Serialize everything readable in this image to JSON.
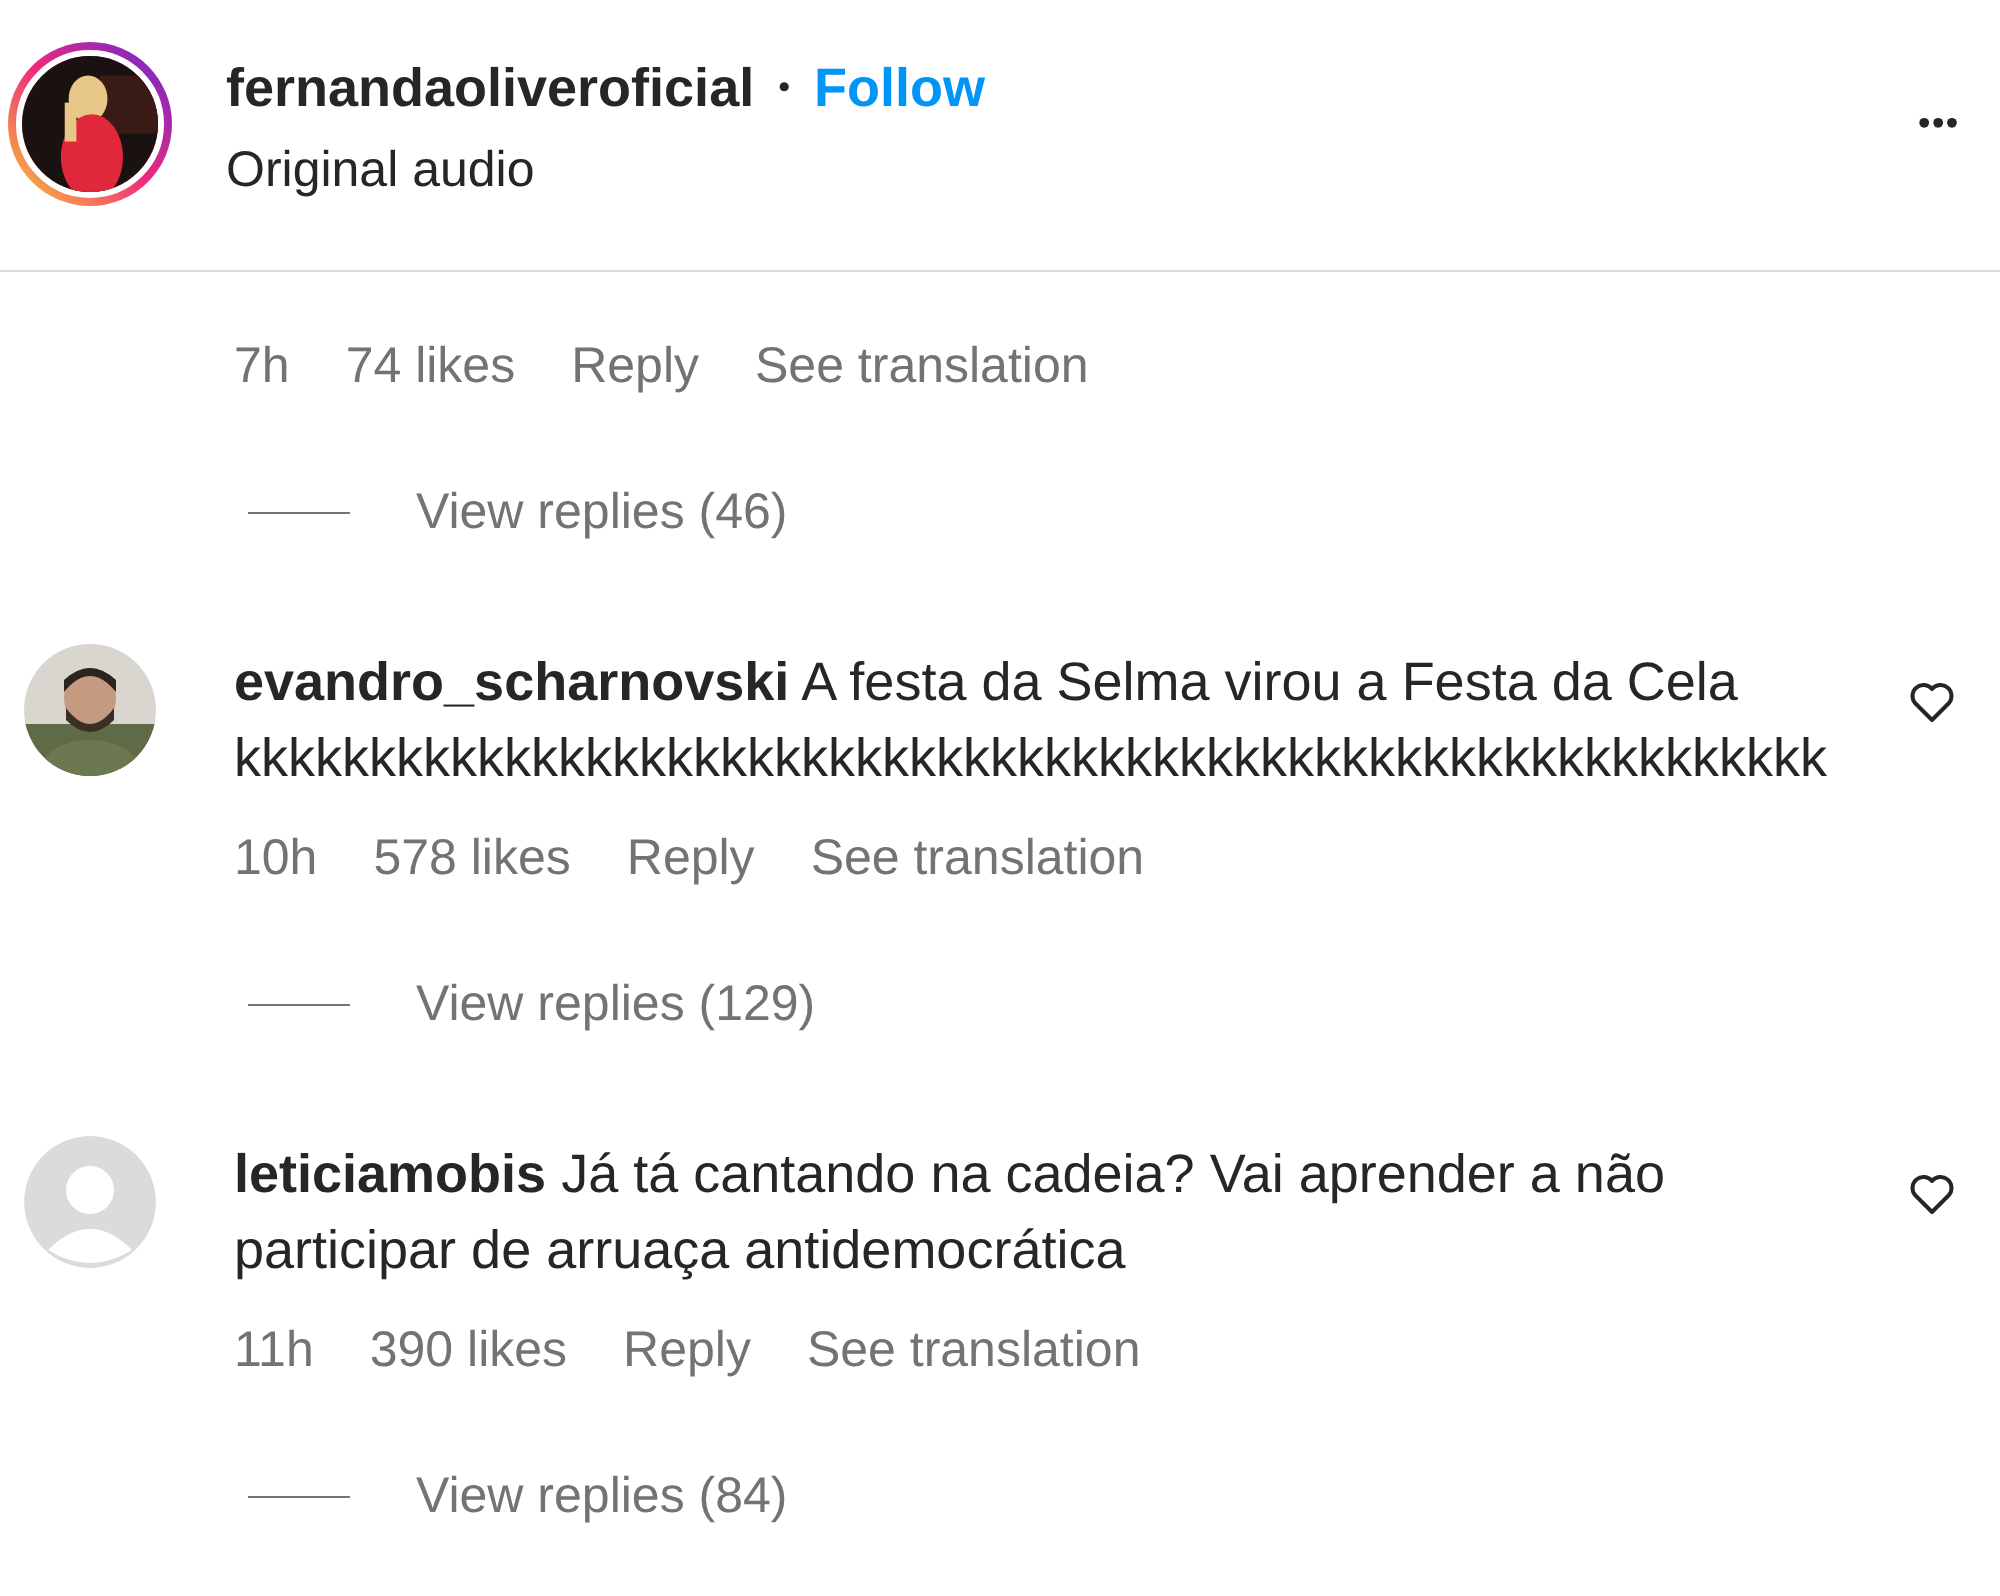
{
  "header": {
    "username": "fernandaoliveroficial",
    "separator": "•",
    "follow": "Follow",
    "subtitle": "Original audio",
    "more": "•••"
  },
  "comments": [
    {
      "kind": "partial",
      "time": "7h",
      "likes": "74 likes",
      "reply": "Reply",
      "translate": "See translation",
      "view_replies": "View replies (46)"
    },
    {
      "username": "evandro_scharnovski",
      "text": "A festa da Selma virou a Festa da Cela kkkkkkkkkkkkkkkkkkkkkkkkkkkkkkkkkkkkkkkkkkkkkkkkkkkkkkkkkkk",
      "time": "10h",
      "likes": "578 likes",
      "reply": "Reply",
      "translate": "See translation",
      "view_replies": "View replies (129)"
    },
    {
      "kind": "default",
      "username": "leticiamobis",
      "text": "Já tá cantando na cadeia? Vai aprender a não participar de arruaça antidemocrática",
      "time": "11h",
      "likes": "390 likes",
      "reply": "Reply",
      "translate": "See translation",
      "view_replies": "View replies (84)"
    }
  ]
}
